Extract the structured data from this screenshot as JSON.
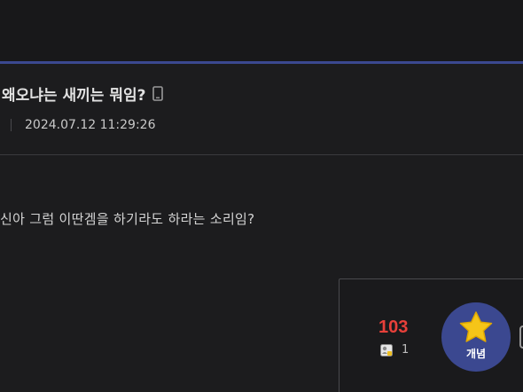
{
  "post": {
    "title": "왜오냐는 새끼는 뭐임?",
    "device_icon": "mobile-phone-icon",
    "datetime": "2024.07.12 11:29:26",
    "body": "신아 그럼 이딴겜을 하기라도 하라는 소리임?"
  },
  "vote": {
    "count": "103",
    "fixed_count": "1",
    "fixed_icon": "fixed-user-icon",
    "recommend_label": "개념",
    "recommend_icon": "star-icon"
  },
  "colors": {
    "accent": "#3b4890",
    "vote_count": "#e8403a",
    "star": "#f5c518",
    "background": "#1c1c1e"
  }
}
